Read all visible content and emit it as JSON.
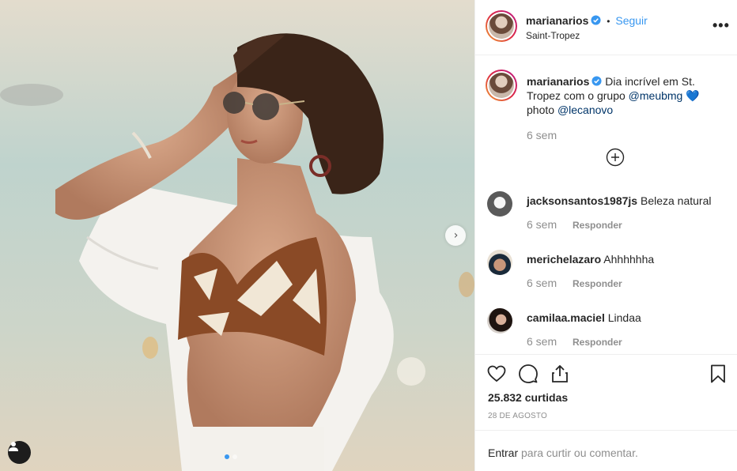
{
  "post": {
    "username": "marianarios",
    "follow_label": "Seguir",
    "separator": "•",
    "location": "Saint-Tropez",
    "more_label": "•••"
  },
  "caption": {
    "username": "marianarios",
    "text_before": "Dia incrível em St. Tropez com o grupo",
    "mention_1": "@meubmg",
    "heart": "💙",
    "text_photo": "photo",
    "mention_2": "@lecanovo",
    "time": "6 sem"
  },
  "comments": [
    {
      "username": "jacksonsantos1987js",
      "text": "Beleza natural",
      "time": "6 sem",
      "reply_label": "Responder"
    },
    {
      "username": "merichelazaro",
      "text": "Ahhhhhha",
      "time": "6 sem",
      "reply_label": "Responder"
    },
    {
      "username": "camilaa.maciel",
      "text": "Lindaa",
      "time": "6 sem",
      "reply_label": "Responder"
    }
  ],
  "stats": {
    "likes": "25.832 curtidas",
    "date": "28 DE AGOSTO"
  },
  "login": {
    "link_label": "Entrar",
    "rest": "para curtir ou comentar."
  },
  "icons": {
    "like": "heart-icon",
    "comment": "comment-icon",
    "share": "share-icon",
    "save": "bookmark-icon",
    "tag": "user-tag-icon",
    "next": "chevron-right-icon",
    "load_more": "plus-circle-icon",
    "verified": "verified-badge-icon"
  },
  "colors": {
    "link": "#3897f0",
    "mention": "#003569",
    "muted": "#8e8e8e",
    "text": "#262626",
    "border": "#efefef"
  }
}
